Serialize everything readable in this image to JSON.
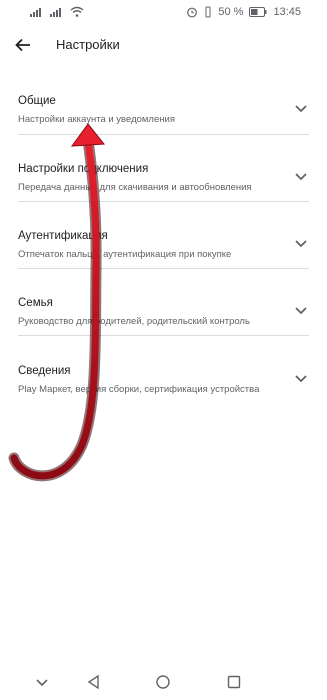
{
  "status": {
    "battery": "50 %",
    "time": "13:45"
  },
  "header": {
    "title": "Настройки"
  },
  "settings": [
    {
      "title": "Общие",
      "subtitle": "Настройки аккаунта и уведомления"
    },
    {
      "title": "Настройки подключения",
      "subtitle": "Передача данных для скачивания и автообновления"
    },
    {
      "title": "Аутентификация",
      "subtitle": "Отпечаток пальца, аутентификация при покупке"
    },
    {
      "title": "Семья",
      "subtitle": "Руководство для родителей, родительский контроль"
    },
    {
      "title": "Сведения",
      "subtitle": "Play Маркет, версия сборки, сертификация устройства"
    }
  ],
  "colors": {
    "annotation_arrow": "#c0101e"
  }
}
